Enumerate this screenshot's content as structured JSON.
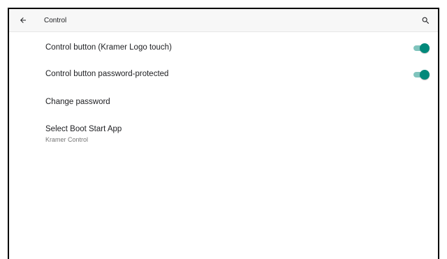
{
  "toolbar": {
    "title": "Control",
    "back_icon": "arrow-left-icon",
    "search_icon": "search-icon"
  },
  "settings": [
    {
      "title": "Control button (Kramer Logo touch)",
      "summary": "",
      "toggle": true,
      "checked": true
    },
    {
      "title": "Control button password-protected",
      "summary": "",
      "toggle": true,
      "checked": true
    },
    {
      "title": "Change password",
      "summary": "",
      "toggle": false
    },
    {
      "title": "Select Boot Start App",
      "summary": "Kramer Control",
      "toggle": false
    }
  ],
  "colors": {
    "accent": "#00897b",
    "accent_track": "#80c4bd",
    "toolbar_bg": "#f7f7f7",
    "text_primary": "#202124",
    "text_secondary": "#757575"
  }
}
